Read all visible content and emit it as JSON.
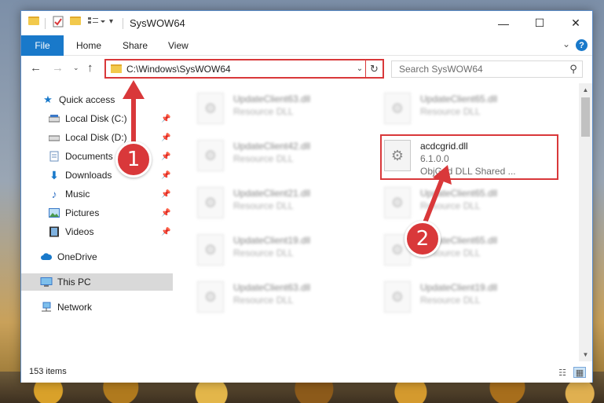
{
  "window": {
    "title": "SysWOW64",
    "minimize_glyph": "—",
    "maximize_glyph": "☐",
    "close_glyph": "✕"
  },
  "ribbon": {
    "tabs": [
      {
        "label": "File"
      },
      {
        "label": "Home"
      },
      {
        "label": "Share"
      },
      {
        "label": "View"
      }
    ],
    "help_glyph": "?"
  },
  "address": {
    "path": "C:\\Windows\\SysWOW64",
    "search_placeholder": "Search SysWOW64"
  },
  "nav_pane": {
    "items": [
      {
        "label": "Quick access",
        "icon": "star-icon",
        "pinned": false
      },
      {
        "label": "Local Disk (C:)",
        "icon": "drive-icon",
        "pinned": true
      },
      {
        "label": "Local Disk (D:)",
        "icon": "drive-icon",
        "pinned": true
      },
      {
        "label": "Documents",
        "icon": "documents-icon",
        "pinned": true
      },
      {
        "label": "Downloads",
        "icon": "download-icon",
        "pinned": true
      },
      {
        "label": "Music",
        "icon": "music-icon",
        "pinned": true
      },
      {
        "label": "Pictures",
        "icon": "pictures-icon",
        "pinned": true
      },
      {
        "label": "Videos",
        "icon": "videos-icon",
        "pinned": true
      },
      {
        "label": "OneDrive",
        "icon": "cloud-icon",
        "pinned": false
      },
      {
        "label": "This PC",
        "icon": "computer-icon",
        "pinned": false,
        "selected": true
      },
      {
        "label": "Network",
        "icon": "network-icon",
        "pinned": false
      }
    ]
  },
  "files": {
    "left_column": [
      {
        "name": "UpdateClient63.dll",
        "type": "Resource DLL"
      },
      {
        "name": "UpdateClient42.dll",
        "type": "Resource DLL"
      },
      {
        "name": "UpdateClient21.dll",
        "type": "Resource DLL"
      },
      {
        "name": "UpdateClient19.dll",
        "type": "Resource DLL"
      },
      {
        "name": "UpdateClient63.dll",
        "type": "Resource DLL"
      }
    ],
    "right_column": [
      {
        "name": "UpdateClient65.dll",
        "type": "Resource DLL"
      },
      {
        "name": "UpdateClient65.dll",
        "type": "Resource DLL"
      },
      {
        "name": "UpdateClient65.dll",
        "type": "Resource DLL"
      },
      {
        "name": "UpdateClient19.dll",
        "type": "Resource DLL"
      }
    ],
    "highlighted": {
      "name": "acdcgrid.dll",
      "version": "6.1.0.0",
      "description": "ObjGrid DLL Shared ..."
    }
  },
  "status": {
    "item_count": "153 items"
  },
  "annotations": {
    "step1": "1",
    "step2": "2"
  },
  "colors": {
    "accent": "#1979ca",
    "highlight_red": "#d9383a"
  }
}
